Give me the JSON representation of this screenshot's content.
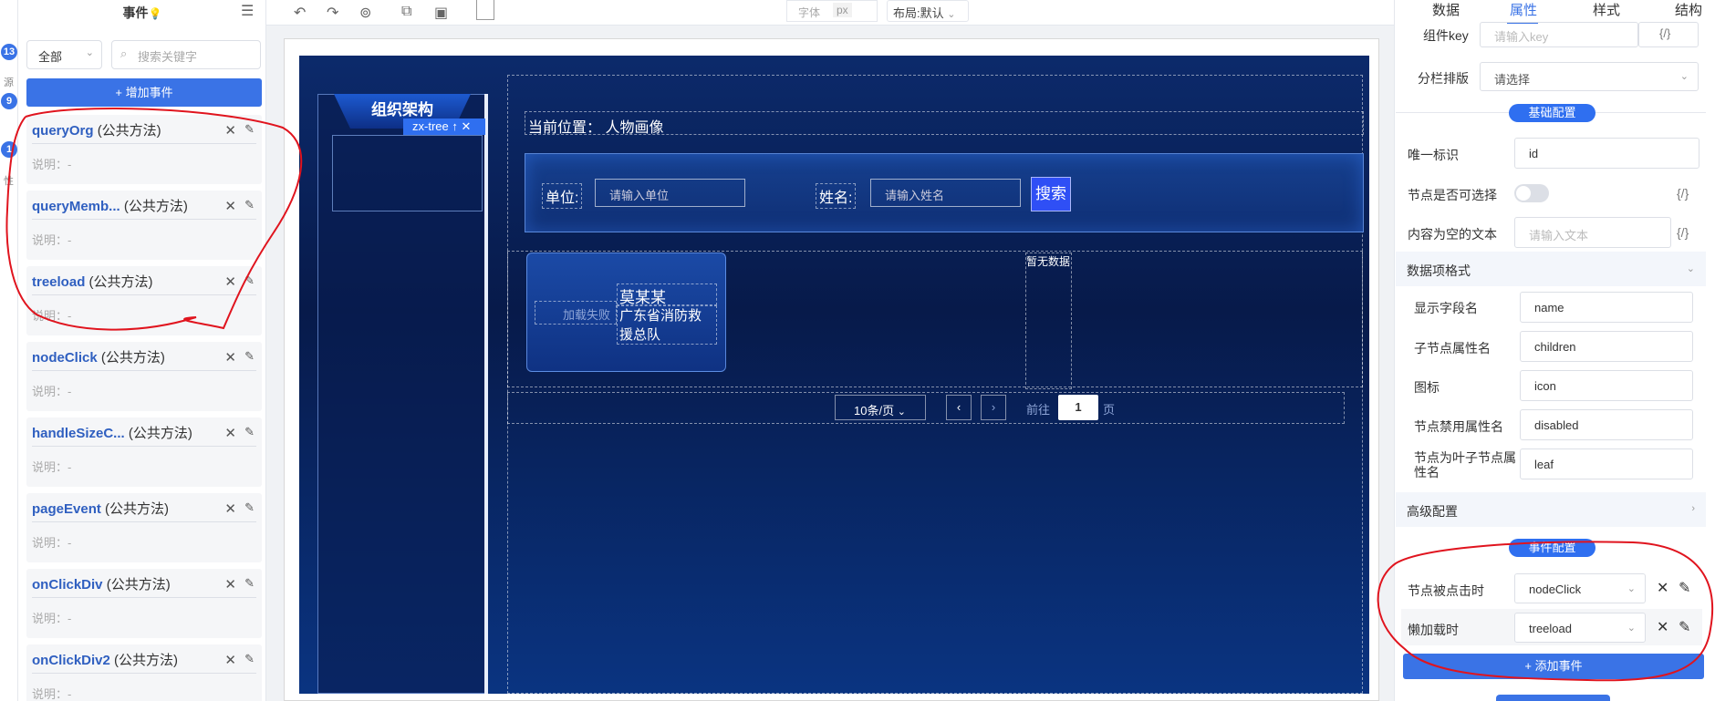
{
  "rail": {
    "badges": [
      "13",
      "9",
      "1"
    ],
    "texts": [
      "源",
      "件",
      "性"
    ]
  },
  "events_panel": {
    "title": "事件",
    "filter": "全部",
    "search_placeholder": "搜索关键字",
    "add_button": "+ 增加事件",
    "items": [
      {
        "name": "queryOrg",
        "tag": "(公共方法)",
        "desc": "说明：-"
      },
      {
        "name": "queryMemb...",
        "tag": "(公共方法)",
        "desc": "说明：-"
      },
      {
        "name": "treeload",
        "tag": "(公共方法)",
        "desc": "说明：-"
      },
      {
        "name": "nodeClick",
        "tag": "(公共方法)",
        "desc": "说明：-"
      },
      {
        "name": "handleSizeC...",
        "tag": "(公共方法)",
        "desc": "说明：-"
      },
      {
        "name": "pageEvent",
        "tag": "(公共方法)",
        "desc": "说明：-"
      },
      {
        "name": "onClickDiv",
        "tag": "(公共方法)",
        "desc": "说明：-"
      },
      {
        "name": "onClickDiv2",
        "tag": "(公共方法)",
        "desc": "说明：-"
      }
    ]
  },
  "toolbar": {
    "font_placeholder": "字体",
    "font_unit": "px",
    "layout": "布局:默认"
  },
  "canvas": {
    "org_title": "组织架构",
    "component_tag": "zx-tree",
    "breadcrumb": "当前位置：  人物画像",
    "unit_label": "单位:",
    "unit_placeholder": "请输入单位",
    "name_label": "姓名:",
    "name_placeholder": "请输入姓名",
    "search_button": "搜索",
    "card": {
      "img_alt": "加载失败",
      "name": "莫某某",
      "org": "广东省消防救援总队"
    },
    "no_data": "暂无数据",
    "pager": {
      "size": "10条/页",
      "goto": "前往",
      "page": "1",
      "page_suffix": "页"
    }
  },
  "props_panel": {
    "tabs": [
      "数据",
      "属性",
      "样式",
      "结构"
    ],
    "active_tab": "属性",
    "component_key_label": "组件key",
    "component_key_placeholder": "请输入key",
    "column_label": "分栏排版",
    "column_placeholder": "请选择",
    "basic_section": "基础配置",
    "id_label": "唯一标识",
    "id_value": "id",
    "selectable_label": "节点是否可选择",
    "empty_text_label": "内容为空的文本",
    "empty_text_placeholder": "请输入文本",
    "data_format_label": "数据项格式",
    "display_field_label": "显示字段名",
    "display_field_value": "name",
    "children_label": "子节点属性名",
    "children_value": "children",
    "icon_label": "图标",
    "icon_value": "icon",
    "disabled_label": "节点禁用属性名",
    "disabled_value": "disabled",
    "leaf_label": "节点为叶子节点属性名",
    "leaf_value": "leaf",
    "advanced_label": "高级配置",
    "event_section": "事件配置",
    "node_click_label": "节点被点击时",
    "node_click_value": "nodeClick",
    "lazy_load_label": "懒加载时",
    "lazy_load_value": "treeload",
    "add_event_button": "+ 添加事件"
  },
  "brace": "{/}",
  "colors": {
    "accent": "#3a73e6",
    "annotation": "#e0141e",
    "canvas_bg": "#0a2460"
  }
}
